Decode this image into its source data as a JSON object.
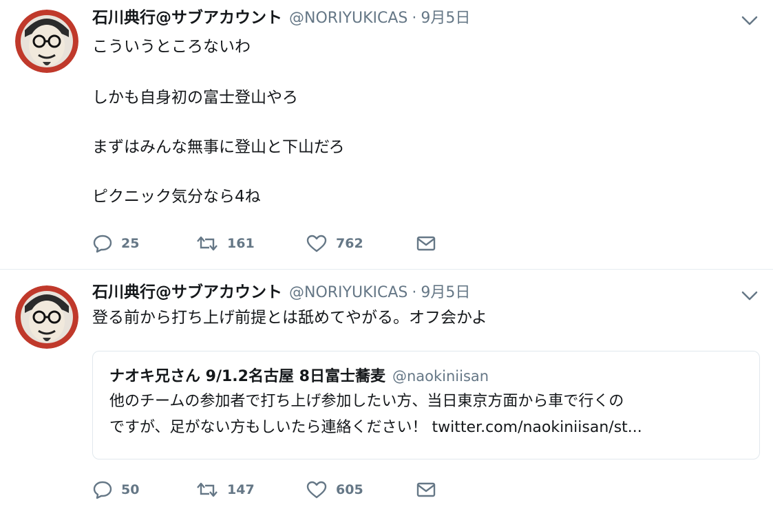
{
  "tweets": [
    {
      "author_name": "石川典行@サブアカウント",
      "handle": "@NORIYUKICAS",
      "separator": "·",
      "date": "9月5日",
      "lines": [
        "こういうところないわ",
        "しかも自身初の富士登山やろ",
        "まずはみんな無事に登山と下山だろ",
        "ピクニック気分なら4ね"
      ],
      "replies": "25",
      "retweets": "161",
      "likes": "762"
    },
    {
      "author_name": "石川典行@サブアカウント",
      "handle": "@NORIYUKICAS",
      "separator": "·",
      "date": "9月5日",
      "text": "登る前から打ち上げ前提とは舐めてやがる。オフ会かよ",
      "quote": {
        "author_name": "ナオキ兄さん 9/1.2名古屋 8日富士蕎麦",
        "handle": "@naokiniisan",
        "lines": [
          "他のチームの参加者で打ち上げ参加したい方、当日東京方面から車で行くの",
          "ですが、足がない方もしいたら連絡ください！ twitter.com/naokiniisan/st..."
        ]
      },
      "replies": "50",
      "retweets": "147",
      "likes": "605"
    }
  ],
  "icons": {
    "caret": "chevron-down-icon",
    "reply": "reply-icon",
    "retweet": "retweet-icon",
    "like": "heart-icon",
    "dm": "envelope-icon"
  },
  "colors": {
    "text": "#14171a",
    "secondary": "#657786",
    "border": "#e6ecf0",
    "avatar_ring": "#c0392b"
  }
}
